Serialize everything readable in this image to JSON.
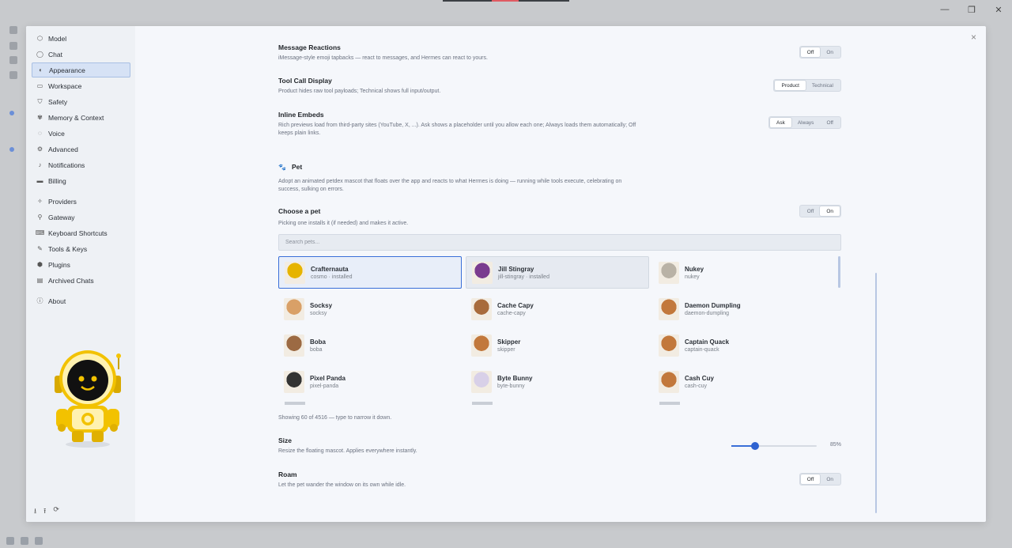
{
  "window": {
    "controls": [
      "—",
      "❐",
      "✕"
    ]
  },
  "dialog": {
    "close_label": "×"
  },
  "sidebar": {
    "items": [
      {
        "label": "Model",
        "icon": "cube-icon"
      },
      {
        "label": "Chat",
        "icon": "chat-bubble-icon"
      },
      {
        "label": "Appearance",
        "icon": "palette-icon",
        "active": true
      },
      {
        "label": "Workspace",
        "icon": "monitor-icon"
      },
      {
        "label": "Safety",
        "icon": "shield-icon"
      },
      {
        "label": "Memory & Context",
        "icon": "brain-icon"
      },
      {
        "label": "Voice",
        "icon": "speech-icon"
      },
      {
        "label": "Advanced",
        "icon": "advanced-icon"
      },
      {
        "label": "Notifications",
        "icon": "bell-icon"
      },
      {
        "label": "Billing",
        "icon": "card-icon"
      }
    ],
    "items2": [
      {
        "label": "Providers",
        "icon": "sparkle-icon"
      },
      {
        "label": "Gateway",
        "icon": "gateway-icon"
      },
      {
        "label": "Keyboard Shortcuts",
        "icon": "keyboard-icon"
      },
      {
        "label": "Tools & Keys",
        "icon": "wrench-icon"
      },
      {
        "label": "Plugins",
        "icon": "plug-icon"
      },
      {
        "label": "Archived Chats",
        "icon": "archive-icon"
      }
    ],
    "items3": [
      {
        "label": "About",
        "icon": "info-icon"
      }
    ],
    "bottom_icons": [
      "download-icon",
      "upload-icon",
      "refresh-icon"
    ]
  },
  "settings": {
    "reactions": {
      "title": "Message Reactions",
      "desc": "iMessage-style emoji tapbacks — react to messages, and Hermes can react to yours.",
      "options": [
        "Off",
        "On"
      ],
      "selected": "Off"
    },
    "tool_call": {
      "title": "Tool Call Display",
      "desc": "Product hides raw tool payloads; Technical shows full input/output.",
      "options": [
        "Product",
        "Technical"
      ],
      "selected": "Product"
    },
    "embeds": {
      "title": "Inline Embeds",
      "desc": "Rich previews load from third-party sites (YouTube, X, ...). Ask shows a placeholder until you allow each one; Always loads them automatically; Off keeps plain links.",
      "options": [
        "Ask",
        "Always",
        "Off"
      ],
      "selected": "Ask"
    },
    "pet_section": {
      "title": "Pet",
      "icon": "paw-icon",
      "desc": "Adopt an animated petdex mascot that floats over the app and reacts to what Hermes is doing — running while tools execute, celebrating on success, sulking on errors."
    },
    "choose_pet": {
      "title": "Choose a pet",
      "desc": "Picking one installs it (if needed) and makes it active.",
      "options": [
        "Off",
        "On"
      ],
      "selected": "On"
    },
    "search": {
      "placeholder": "Search pets..."
    },
    "pets": [
      {
        "name": "Crafternauta",
        "sub": "cosmo · installed",
        "color": "#e6b400",
        "state": "selected"
      },
      {
        "name": "Jill Stingray",
        "sub": "jill-stingray · installed",
        "color": "#7a3b8f",
        "state": "installed"
      },
      {
        "name": "Nukey",
        "sub": "nukey",
        "color": "#b9b2a6",
        "state": "normal"
      },
      {
        "name": "Socksy",
        "sub": "socksy",
        "color": "#d9a067",
        "state": "normal"
      },
      {
        "name": "Cache Capy",
        "sub": "cache-capy",
        "color": "#a86b3c",
        "state": "normal"
      },
      {
        "name": "Daemon Dumpling",
        "sub": "daemon-dumpling",
        "color": "#c2783c",
        "state": "normal"
      },
      {
        "name": "Boba",
        "sub": "boba",
        "color": "#9c6a43",
        "state": "normal"
      },
      {
        "name": "Skipper",
        "sub": "skipper",
        "color": "#c2783c",
        "state": "normal"
      },
      {
        "name": "Captain Quack",
        "sub": "captain-quack",
        "color": "#c2783c",
        "state": "normal"
      },
      {
        "name": "Pixel Panda",
        "sub": "pixel-panda",
        "color": "#333333",
        "state": "normal"
      },
      {
        "name": "Byte Bunny",
        "sub": "byte-bunny",
        "color": "#d8d0e8",
        "state": "normal"
      },
      {
        "name": "Cash Cuy",
        "sub": "cash-cuy",
        "color": "#c2783c",
        "state": "normal"
      }
    ],
    "showing": "Showing 60 of 4516 — type to narrow it down.",
    "size": {
      "title": "Size",
      "desc": "Resize the floating mascot. Applies everywhere instantly.",
      "value_label": "85%",
      "value": 0.28
    },
    "roam": {
      "title": "Roam",
      "desc": "Let the pet wander the window on its own while idle.",
      "options": [
        "Off",
        "On"
      ],
      "selected": "Off"
    }
  }
}
